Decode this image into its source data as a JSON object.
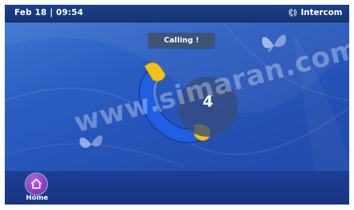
{
  "statusbar": {
    "datetime": "Feb 18 | 09:54",
    "app_name": "Intercom",
    "app_icon": "intercom-icon"
  },
  "call": {
    "status_label": "Calling !",
    "countdown": "4",
    "icon": "phone-handset-icon"
  },
  "watermark": "www.simaran.com",
  "bottombar": {
    "home_label": "Home",
    "home_icon": "home-icon"
  },
  "colors": {
    "background": "#2a5cc0",
    "statusbar": "#1b3f8c",
    "handset_blue": "#1f5fe0",
    "handset_yellow": "#f3c21a",
    "home_button": "#8a3cc4"
  }
}
